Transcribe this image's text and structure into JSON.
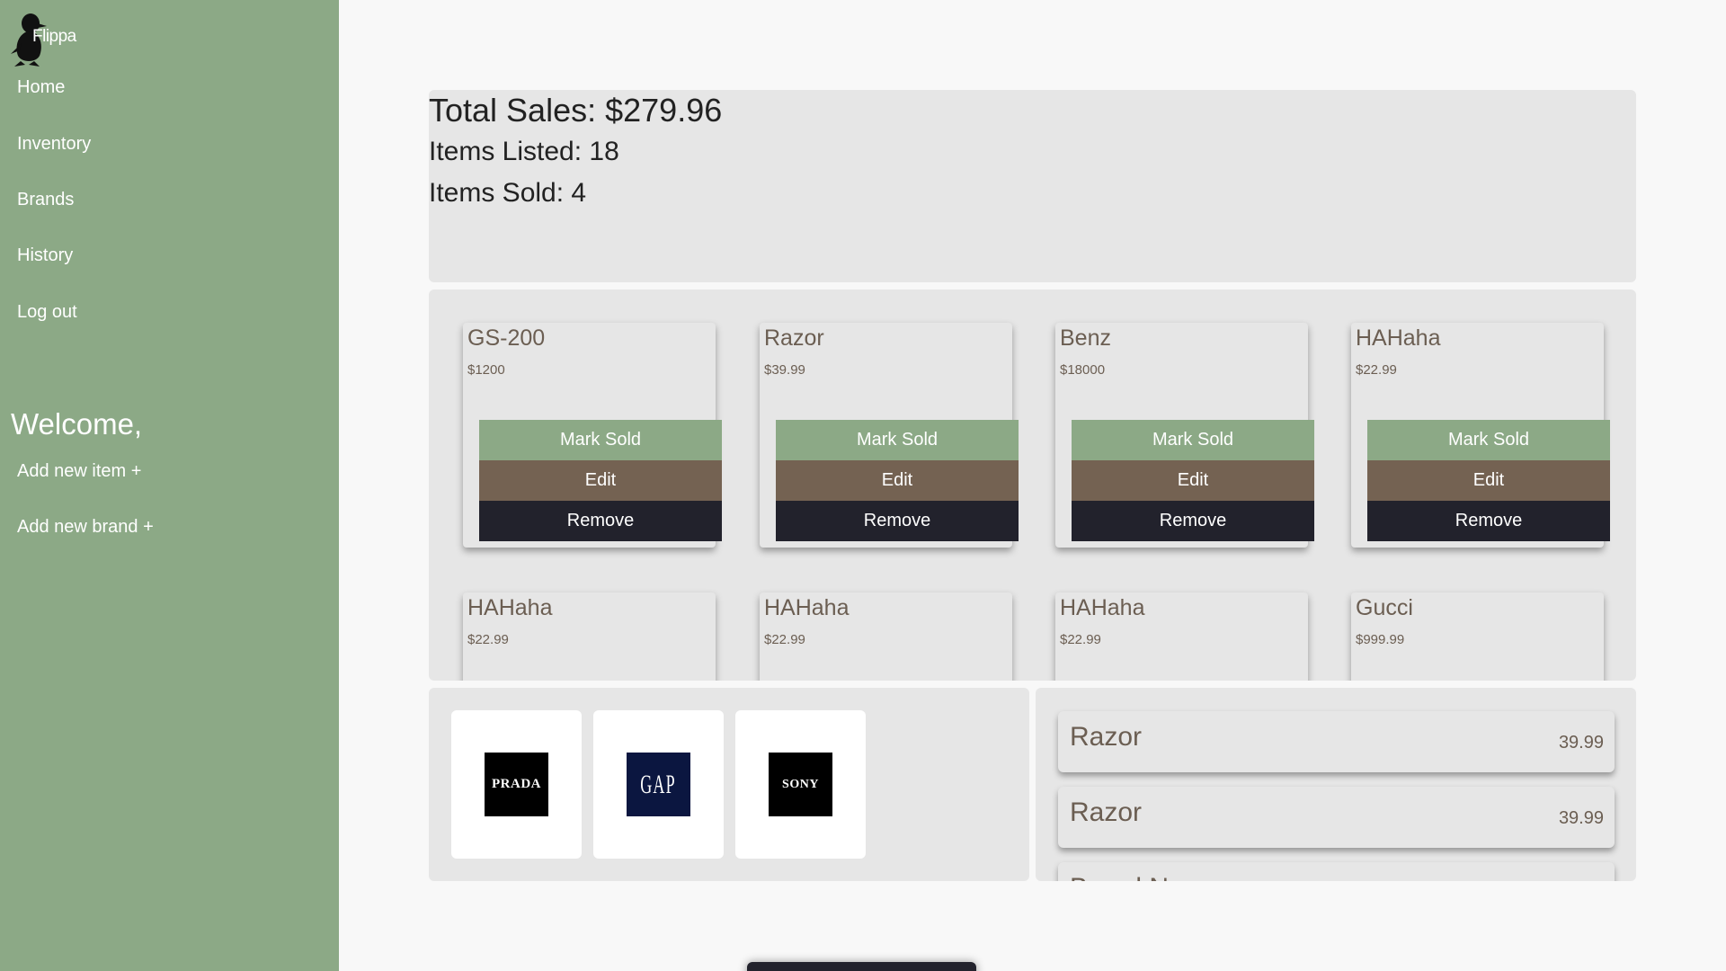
{
  "app": {
    "name": "Flippa"
  },
  "nav": {
    "home": "Home",
    "inventory": "Inventory",
    "brands": "Brands",
    "history": "History",
    "logout": "Log out"
  },
  "welcome": "Welcome,",
  "actions": {
    "add_item": "Add new item +",
    "add_brand": "Add new brand +"
  },
  "stats": {
    "total_sales": "Total Sales: $279.96",
    "items_listed": "Items Listed: 18",
    "items_sold": "Items Sold: 4"
  },
  "buttons": {
    "mark_sold": "Mark Sold",
    "edit": "Edit",
    "remove": "Remove"
  },
  "items": [
    {
      "name": "GS-200",
      "price": "$1200"
    },
    {
      "name": "Razor",
      "price": "$39.99"
    },
    {
      "name": "Benz",
      "price": "$18000"
    },
    {
      "name": "HAHaha",
      "price": "$22.99"
    },
    {
      "name": "HAHaha",
      "price": "$22.99"
    },
    {
      "name": "HAHaha",
      "price": "$22.99"
    },
    {
      "name": "HAHaha",
      "price": "$22.99"
    },
    {
      "name": "Gucci",
      "price": "$999.99"
    }
  ],
  "brands": [
    {
      "name": "PRADA",
      "color": "#000000"
    },
    {
      "name": "GAP",
      "color": "#0b1640"
    },
    {
      "name": "SONY",
      "color": "#000000"
    }
  ],
  "history": [
    {
      "name": "Razor",
      "price": "39.99"
    },
    {
      "name": "Razor",
      "price": "39.99"
    },
    {
      "name": "Brand N",
      "price": ""
    }
  ]
}
